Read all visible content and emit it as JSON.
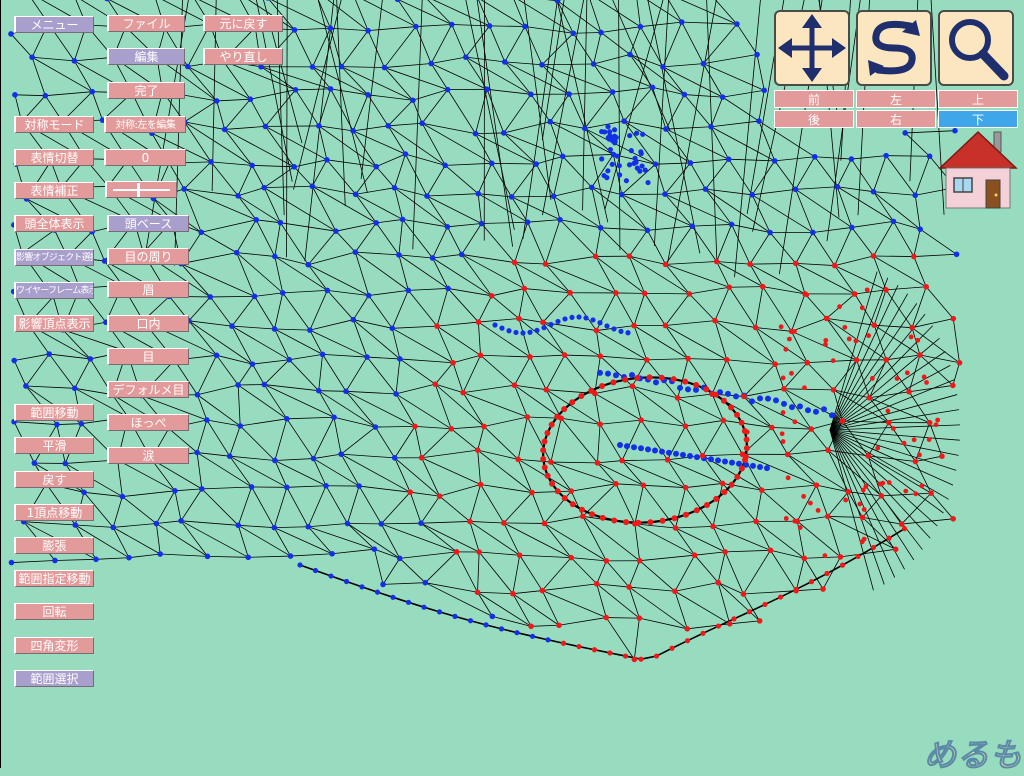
{
  "left_col": [
    {
      "id": "menu",
      "label": "メニュー",
      "style": "lav"
    },
    {
      "id": "symmetry-mode",
      "label": "対称モード",
      "style": "pink"
    },
    {
      "id": "expression-switch",
      "label": "表情切替",
      "style": "pink"
    },
    {
      "id": "expression-correct",
      "label": "表情補正",
      "style": "pink"
    },
    {
      "id": "head-full-view",
      "label": "頭全体表示",
      "style": "pink"
    },
    {
      "id": "influence-object-select",
      "label": "影響オブジェクト選択",
      "style": "lav"
    },
    {
      "id": "wireframe-view",
      "label": "ワイヤーフレーム表示",
      "style": "lav"
    },
    {
      "id": "influence-vertex-view",
      "label": "影響頂点表示",
      "style": "pink"
    },
    {
      "id": "range-move",
      "label": "範囲移動",
      "style": "pink"
    },
    {
      "id": "smooth",
      "label": "平滑",
      "style": "pink"
    },
    {
      "id": "restore",
      "label": "戻す",
      "style": "pink"
    },
    {
      "id": "one-vertex-move",
      "label": "1頂点移動",
      "style": "pink"
    },
    {
      "id": "expand",
      "label": "膨張",
      "style": "pink"
    },
    {
      "id": "range-specified-move",
      "label": "範囲指定移動",
      "style": "pink"
    },
    {
      "id": "rotate",
      "label": "回転",
      "style": "pink"
    },
    {
      "id": "quad-deform",
      "label": "四角変形",
      "style": "pink"
    },
    {
      "id": "range-select",
      "label": "範囲選択",
      "style": "lav"
    }
  ],
  "mid_col": [
    {
      "id": "file",
      "label": "ファイル",
      "style": "pink"
    },
    {
      "id": "edit",
      "label": "編集",
      "style": "lav"
    },
    {
      "id": "done",
      "label": "完了",
      "style": "pink"
    },
    {
      "id": "symmetry-left-edit",
      "label": "対称:左を編集",
      "style": "pink"
    },
    {
      "id": "expression-index",
      "label": "0",
      "style": "pink"
    },
    {
      "id": "head-base",
      "label": "頭ベース",
      "style": "lav"
    },
    {
      "id": "around-eyes",
      "label": "目の周り",
      "style": "pink"
    },
    {
      "id": "eyebrow",
      "label": "眉",
      "style": "pink"
    },
    {
      "id": "mouth-inside",
      "label": "口内",
      "style": "pink"
    },
    {
      "id": "eye",
      "label": "目",
      "style": "pink"
    },
    {
      "id": "deformed-eye",
      "label": "デフォルメ目",
      "style": "pink"
    },
    {
      "id": "cheek",
      "label": "ほっぺ",
      "style": "pink"
    },
    {
      "id": "tears",
      "label": "涙",
      "style": "pink"
    }
  ],
  "right_col": [
    {
      "id": "undo",
      "label": "元に戻す",
      "style": "pink"
    },
    {
      "id": "redo",
      "label": "やり直し",
      "style": "pink"
    }
  ],
  "tools": [
    {
      "id": "move",
      "icon": "move-arrows-icon"
    },
    {
      "id": "rotate",
      "icon": "rotate-icon"
    },
    {
      "id": "zoom",
      "icon": "magnifier-icon"
    }
  ],
  "directions": [
    {
      "id": "front",
      "label": "前",
      "active": false
    },
    {
      "id": "left",
      "label": "左",
      "active": false
    },
    {
      "id": "top",
      "label": "上",
      "active": false
    },
    {
      "id": "back",
      "label": "後",
      "active": false
    },
    {
      "id": "right",
      "label": "右",
      "active": false
    },
    {
      "id": "bottom",
      "label": "下",
      "active": true
    }
  ],
  "home_icon": "house-icon",
  "logo_text": "めるも",
  "colors": {
    "background": "#98dcc0",
    "button_pink": "#e39a9a",
    "button_lavender": "#a99fcc",
    "active_blue": "#3fa6ea",
    "vertex_blue": "#1430e6",
    "vertex_red": "#f01818",
    "wire": "#000000"
  }
}
